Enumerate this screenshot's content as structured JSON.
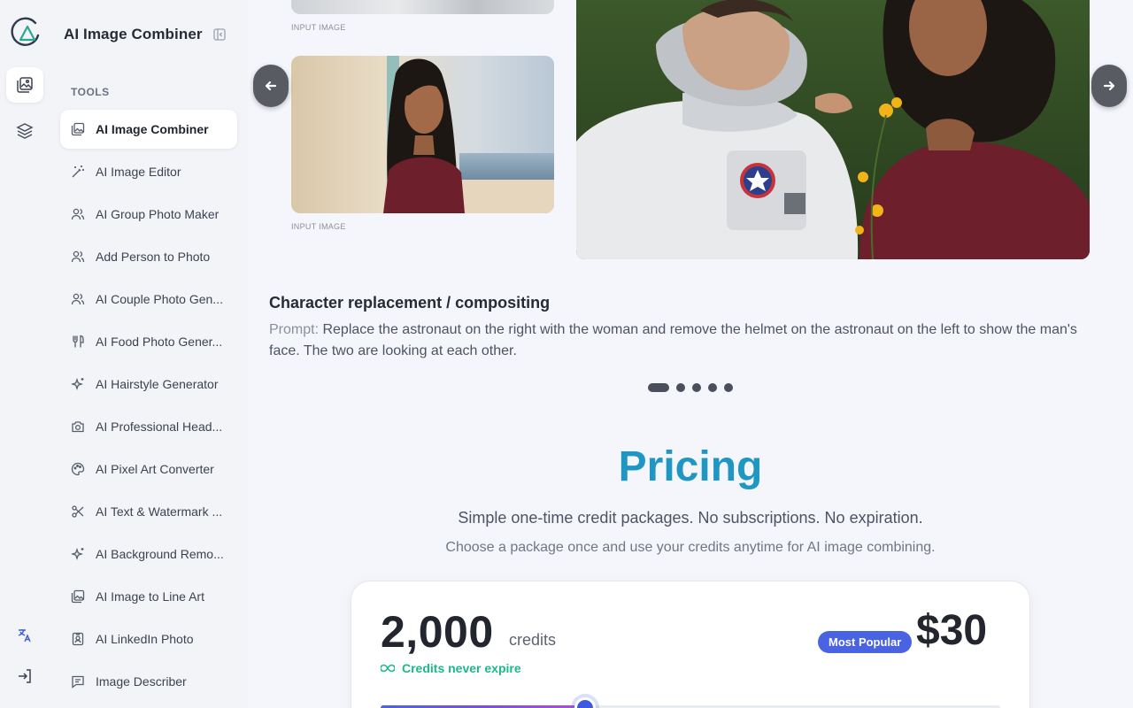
{
  "app": {
    "title": "AI Image Combiner"
  },
  "sidebar": {
    "section_label": "TOOLS",
    "items": [
      {
        "label": "AI Image Combiner",
        "icon": "image-stack-icon",
        "active": true
      },
      {
        "label": "AI Image Editor",
        "icon": "magic-wand-icon"
      },
      {
        "label": "AI Group Photo Maker",
        "icon": "users-icon"
      },
      {
        "label": "Add Person to Photo",
        "icon": "users-icon"
      },
      {
        "label": "AI Couple Photo Gen...",
        "icon": "users-icon"
      },
      {
        "label": "AI Food Photo Gener...",
        "icon": "utensils-icon"
      },
      {
        "label": "AI Hairstyle Generator",
        "icon": "sparkles-icon"
      },
      {
        "label": "AI Professional Head...",
        "icon": "camera-icon"
      },
      {
        "label": "AI Pixel Art Converter",
        "icon": "palette-icon"
      },
      {
        "label": "AI Text & Watermark ...",
        "icon": "scissors-icon"
      },
      {
        "label": "AI Background Remo...",
        "icon": "sparkles-icon"
      },
      {
        "label": "AI Image to Line Art",
        "icon": "image-stack-icon"
      },
      {
        "label": "AI LinkedIn Photo",
        "icon": "id-badge-icon"
      },
      {
        "label": "Image Describer",
        "icon": "message-icon"
      }
    ]
  },
  "gallery": {
    "input_label_1": "INPUT IMAGE",
    "input_label_2": "INPUT IMAGE",
    "example_title": "Character replacement / compositing",
    "prompt_key": "Prompt:",
    "prompt_text": " Replace the astronaut on the right with the woman and remove the helmet on the astronaut on the left to show the man's face. The two are looking at each other.",
    "dot_count": 5,
    "active_dot": 0
  },
  "pricing": {
    "title": "Pricing",
    "subtitle": "Simple one-time credit packages. No subscriptions. No expiration.",
    "description": "Choose a package once and use your credits anytime for AI image combining.",
    "card": {
      "credits": "2,000",
      "credits_unit": "credits",
      "never_expire": "Credits never expire",
      "badge": "Most Popular",
      "price": "$30",
      "slider_fraction": 0.33
    }
  },
  "colors": {
    "accent": "#2097c2",
    "badge": "#4a63e3",
    "success": "#1bb98a"
  }
}
